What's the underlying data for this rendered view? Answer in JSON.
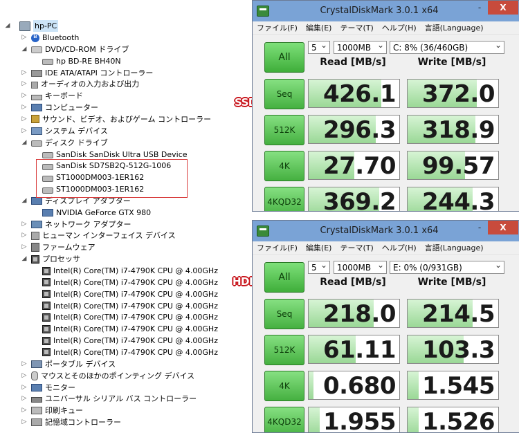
{
  "device_manager": {
    "root": "hp-PC",
    "nodes": [
      {
        "label": "Bluetooth",
        "level": 1,
        "icon": "bluetooth-icon",
        "arrow": "collapsed"
      },
      {
        "label": "DVD/CD-ROM ドライブ",
        "level": 1,
        "icon": "dvd-drive-icon",
        "arrow": "expanded"
      },
      {
        "label": "hp BD-RE  BH40N",
        "level": 2,
        "icon": "disc-drive-icon",
        "arrow": ""
      },
      {
        "label": "IDE ATA/ATAPI コントローラー",
        "level": 1,
        "icon": "ide-controller-icon",
        "arrow": "collapsed"
      },
      {
        "label": "オーディオの入力および出力",
        "level": 1,
        "icon": "speaker-icon",
        "arrow": "collapsed"
      },
      {
        "label": "キーボード",
        "level": 1,
        "icon": "keyboard-icon",
        "arrow": "collapsed"
      },
      {
        "label": "コンピューター",
        "level": 1,
        "icon": "computer-icon",
        "arrow": "collapsed"
      },
      {
        "label": "サウンド、ビデオ、およびゲーム コントローラー",
        "level": 1,
        "icon": "sound-icon",
        "arrow": "collapsed"
      },
      {
        "label": "システム デバイス",
        "level": 1,
        "icon": "system-device-icon",
        "arrow": "collapsed"
      },
      {
        "label": "ディスク ドライブ",
        "level": 1,
        "icon": "disk-drive-icon",
        "arrow": "expanded"
      },
      {
        "label": "SanDisk SanDisk Ultra USB Device",
        "level": 2,
        "icon": "disk-drive-icon",
        "arrow": ""
      },
      {
        "label": "SanDisk SD7SB2Q-512G-1006",
        "level": 2,
        "icon": "disk-drive-icon",
        "arrow": ""
      },
      {
        "label": "ST1000DM003-1ER162",
        "level": 2,
        "icon": "disk-drive-icon",
        "arrow": ""
      },
      {
        "label": "ST1000DM003-1ER162",
        "level": 2,
        "icon": "disk-drive-icon",
        "arrow": ""
      },
      {
        "label": "ディスプレイ アダプター",
        "level": 1,
        "icon": "display-adapter-icon",
        "arrow": "expanded"
      },
      {
        "label": "NVIDIA GeForce GTX 980",
        "level": 2,
        "icon": "display-adapter-icon",
        "arrow": ""
      },
      {
        "label": "ネットワーク アダプター",
        "level": 1,
        "icon": "network-adapter-icon",
        "arrow": "collapsed"
      },
      {
        "label": "ヒューマン インターフェイス デバイス",
        "level": 1,
        "icon": "hid-icon",
        "arrow": "collapsed"
      },
      {
        "label": "ファームウェア",
        "level": 1,
        "icon": "firmware-icon",
        "arrow": "collapsed"
      },
      {
        "label": "プロセッサ",
        "level": 1,
        "icon": "processor-icon",
        "arrow": "expanded"
      },
      {
        "label": "Intel(R) Core(TM) i7-4790K CPU @ 4.00GHz",
        "level": 2,
        "icon": "processor-icon",
        "arrow": ""
      },
      {
        "label": "Intel(R) Core(TM) i7-4790K CPU @ 4.00GHz",
        "level": 2,
        "icon": "processor-icon",
        "arrow": ""
      },
      {
        "label": "Intel(R) Core(TM) i7-4790K CPU @ 4.00GHz",
        "level": 2,
        "icon": "processor-icon",
        "arrow": ""
      },
      {
        "label": "Intel(R) Core(TM) i7-4790K CPU @ 4.00GHz",
        "level": 2,
        "icon": "processor-icon",
        "arrow": ""
      },
      {
        "label": "Intel(R) Core(TM) i7-4790K CPU @ 4.00GHz",
        "level": 2,
        "icon": "processor-icon",
        "arrow": ""
      },
      {
        "label": "Intel(R) Core(TM) i7-4790K CPU @ 4.00GHz",
        "level": 2,
        "icon": "processor-icon",
        "arrow": ""
      },
      {
        "label": "Intel(R) Core(TM) i7-4790K CPU @ 4.00GHz",
        "level": 2,
        "icon": "processor-icon",
        "arrow": ""
      },
      {
        "label": "Intel(R) Core(TM) i7-4790K CPU @ 4.00GHz",
        "level": 2,
        "icon": "processor-icon",
        "arrow": ""
      },
      {
        "label": "ポータブル デバイス",
        "level": 1,
        "icon": "portable-device-icon",
        "arrow": "collapsed"
      },
      {
        "label": "マウスとそのほかのポインティング デバイス",
        "level": 1,
        "icon": "mouse-icon",
        "arrow": "collapsed"
      },
      {
        "label": "モニター",
        "level": 1,
        "icon": "monitor-icon",
        "arrow": "collapsed"
      },
      {
        "label": "ユニバーサル シリアル バス コントローラー",
        "level": 1,
        "icon": "usb-controller-icon",
        "arrow": "collapsed"
      },
      {
        "label": "印刷キュー",
        "level": 1,
        "icon": "printer-icon",
        "arrow": "collapsed"
      },
      {
        "label": "記憶域コントローラー",
        "level": 1,
        "icon": "storage-controller-icon",
        "arrow": "collapsed"
      }
    ]
  },
  "labels": {
    "ssd": "SSD",
    "hdd": "HDD"
  },
  "windows": [
    {
      "id": "ssd",
      "title": "CrystalDiskMark 3.0.1 x64",
      "menu": [
        "ファイル(F)",
        "編集(E)",
        "テーマ(T)",
        "ヘルプ(H)",
        "言語(Language)"
      ],
      "all_label": "All",
      "count": "5",
      "size": "1000MB",
      "drive": "C: 8% (36/460GB)",
      "read_header": "Read [MB/s]",
      "write_header": "Write [MB/s]",
      "rows": [
        {
          "label": "Seq",
          "read": "426.1",
          "write": "372.0",
          "read_fill": 0.8,
          "write_fill": 0.76
        },
        {
          "label": "512K",
          "read": "296.3",
          "write": "318.9",
          "read_fill": 0.74,
          "write_fill": 0.75
        },
        {
          "label": "4K",
          "read": "27.70",
          "write": "99.57",
          "read_fill": 0.5,
          "write_fill": 0.63
        },
        {
          "label": "4K\nQD32",
          "read": "369.2",
          "write": "244.3",
          "read_fill": 0.78,
          "write_fill": 0.72
        }
      ],
      "close_label": "X",
      "minimize_label": "-"
    },
    {
      "id": "hdd",
      "title": "CrystalDiskMark 3.0.1 x64",
      "menu": [
        "ファイル(F)",
        "編集(E)",
        "テーマ(T)",
        "ヘルプ(H)",
        "言語(Language)"
      ],
      "all_label": "All",
      "count": "5",
      "size": "1000MB",
      "drive": "E: 0% (0/931GB)",
      "read_header": "Read [MB/s]",
      "write_header": "Write [MB/s]",
      "rows": [
        {
          "label": "Seq",
          "read": "218.0",
          "write": "214.5",
          "read_fill": 0.72,
          "write_fill": 0.72
        },
        {
          "label": "512K",
          "read": "61.11",
          "write": "103.3",
          "read_fill": 0.52,
          "write_fill": 0.62
        },
        {
          "label": "4K",
          "read": "0.680",
          "write": "1.545",
          "read_fill": 0.05,
          "write_fill": 0.12
        },
        {
          "label": "4K\nQD32",
          "read": "1.955",
          "write": "1.526",
          "read_fill": 0.12,
          "write_fill": 0.12
        }
      ],
      "close_label": "X",
      "minimize_label": "-"
    }
  ]
}
